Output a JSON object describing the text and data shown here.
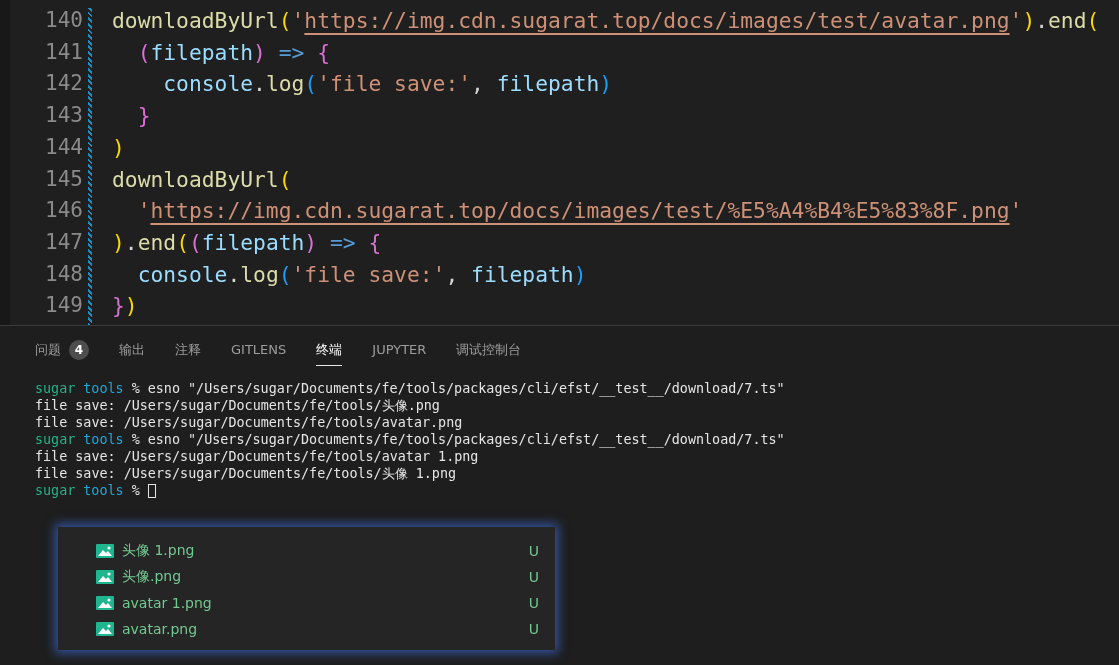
{
  "editor": {
    "lines": [
      {
        "number": "140",
        "tokens": [
          {
            "t": "downloadByUrl",
            "kind": "fn"
          },
          {
            "t": "(",
            "kind": "b1"
          },
          {
            "t": "'",
            "kind": "str"
          },
          {
            "t": "https://img.cdn.sugarat.top/docs/images/test/avatar.png",
            "kind": "link"
          },
          {
            "t": "'",
            "kind": "str"
          },
          {
            "t": ")",
            "kind": "b1"
          },
          {
            "t": ".",
            "kind": "punct"
          },
          {
            "t": "end",
            "kind": "fn"
          },
          {
            "t": "(",
            "kind": "b1"
          }
        ]
      },
      {
        "number": "141",
        "tokens": [
          {
            "t": "  (",
            "kind": "b2"
          },
          {
            "t": "filepath",
            "kind": "var"
          },
          {
            "t": ")",
            "kind": "b2"
          },
          {
            "t": " => ",
            "kind": "kw"
          },
          {
            "t": "{",
            "kind": "b2"
          }
        ]
      },
      {
        "number": "142",
        "tokens": [
          {
            "t": "    console",
            "kind": "var"
          },
          {
            "t": ".",
            "kind": "punct"
          },
          {
            "t": "log",
            "kind": "fn"
          },
          {
            "t": "(",
            "kind": "b3"
          },
          {
            "t": "'file save:'",
            "kind": "str"
          },
          {
            "t": ", ",
            "kind": "punct"
          },
          {
            "t": "filepath",
            "kind": "var"
          },
          {
            "t": ")",
            "kind": "b3"
          }
        ]
      },
      {
        "number": "143",
        "tokens": [
          {
            "t": "  }",
            "kind": "b2"
          }
        ]
      },
      {
        "number": "144",
        "tokens": [
          {
            "t": ")",
            "kind": "b1"
          }
        ]
      },
      {
        "number": "145",
        "tokens": [
          {
            "t": "downloadByUrl",
            "kind": "fn"
          },
          {
            "t": "(",
            "kind": "b1"
          }
        ]
      },
      {
        "number": "146",
        "tokens": [
          {
            "t": "  '",
            "kind": "str"
          },
          {
            "t": "https://img.cdn.sugarat.top/docs/images/test/%E5%A4%B4%E5%83%8F.png",
            "kind": "link"
          },
          {
            "t": "'",
            "kind": "str"
          }
        ]
      },
      {
        "number": "147",
        "tokens": [
          {
            "t": ")",
            "kind": "b1"
          },
          {
            "t": ".",
            "kind": "punct"
          },
          {
            "t": "end",
            "kind": "fn"
          },
          {
            "t": "(",
            "kind": "b1"
          },
          {
            "t": "(",
            "kind": "b2"
          },
          {
            "t": "filepath",
            "kind": "var"
          },
          {
            "t": ")",
            "kind": "b2"
          },
          {
            "t": " => ",
            "kind": "kw"
          },
          {
            "t": "{",
            "kind": "b2"
          }
        ]
      },
      {
        "number": "148",
        "tokens": [
          {
            "t": "  console",
            "kind": "var"
          },
          {
            "t": ".",
            "kind": "punct"
          },
          {
            "t": "log",
            "kind": "fn"
          },
          {
            "t": "(",
            "kind": "b3"
          },
          {
            "t": "'file save:'",
            "kind": "str"
          },
          {
            "t": ", ",
            "kind": "punct"
          },
          {
            "t": "filepath",
            "kind": "var"
          },
          {
            "t": ")",
            "kind": "b3"
          }
        ]
      },
      {
        "number": "149",
        "tokens": [
          {
            "t": "}",
            "kind": "b2"
          },
          {
            "t": ")",
            "kind": "b1"
          }
        ]
      }
    ]
  },
  "panel": {
    "tabs": [
      {
        "label": "问题",
        "badge": "4",
        "selected": false
      },
      {
        "label": "输出",
        "selected": false
      },
      {
        "label": "注释",
        "selected": false
      },
      {
        "label": "GITLENS",
        "selected": false
      },
      {
        "label": "终端",
        "selected": true
      },
      {
        "label": "JUPYTER",
        "selected": false
      },
      {
        "label": "调试控制台",
        "selected": false
      }
    ],
    "terminal": [
      {
        "segments": [
          {
            "t": "sugar",
            "kind": "user"
          },
          {
            "t": "tools",
            "kind": "dir"
          },
          {
            "t": "% esno \"/Users/sugar/Documents/fe/tools/packages/cli/efst/__test__/download/7.ts\"",
            "kind": "text"
          }
        ]
      },
      {
        "segments": [
          {
            "t": "file save: /Users/sugar/Documents/fe/tools/头像.png",
            "kind": "text"
          }
        ]
      },
      {
        "segments": [
          {
            "t": "file save: /Users/sugar/Documents/fe/tools/avatar.png",
            "kind": "text"
          }
        ]
      },
      {
        "segments": [
          {
            "t": "sugar",
            "kind": "user"
          },
          {
            "t": "tools",
            "kind": "dir"
          },
          {
            "t": "% esno \"/Users/sugar/Documents/fe/tools/packages/cli/efst/__test__/download/7.ts\"",
            "kind": "text"
          }
        ]
      },
      {
        "segments": [
          {
            "t": "file save: /Users/sugar/Documents/fe/tools/avatar 1.png",
            "kind": "text"
          }
        ]
      },
      {
        "segments": [
          {
            "t": "file save: /Users/sugar/Documents/fe/tools/头像 1.png",
            "kind": "text"
          }
        ]
      },
      {
        "segments": [
          {
            "t": "sugar",
            "kind": "user"
          },
          {
            "t": "tools",
            "kind": "dir"
          },
          {
            "t": "%",
            "kind": "text"
          },
          {
            "kind": "cursor"
          }
        ]
      }
    ]
  },
  "file_list": {
    "items": [
      {
        "name": "头像 1.png",
        "status": "U"
      },
      {
        "name": "头像.png",
        "status": "U"
      },
      {
        "name": "avatar 1.png",
        "status": "U"
      },
      {
        "name": "avatar.png",
        "status": "U"
      }
    ]
  }
}
